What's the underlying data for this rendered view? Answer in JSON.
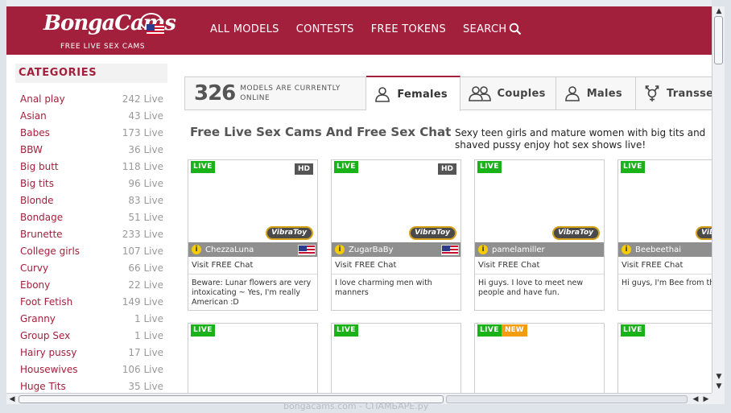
{
  "header": {
    "logo_text": "BongaCams",
    "tagline": "FREE LIVE SEX CAMS",
    "nav": [
      "ALL MODELS",
      "CONTESTS",
      "FREE TOKENS",
      "SEARCH"
    ]
  },
  "sidebar": {
    "title": "CATEGORIES",
    "categories": [
      {
        "name": "Anal play",
        "count": "242 Live"
      },
      {
        "name": "Asian",
        "count": "43 Live"
      },
      {
        "name": "Babes",
        "count": "173 Live"
      },
      {
        "name": "BBW",
        "count": "36 Live"
      },
      {
        "name": "Big butt",
        "count": "118 Live"
      },
      {
        "name": "Big tits",
        "count": "96 Live"
      },
      {
        "name": "Blonde",
        "count": "83 Live"
      },
      {
        "name": "Bondage",
        "count": "51 Live"
      },
      {
        "name": "Brunette",
        "count": "233 Live"
      },
      {
        "name": "College girls",
        "count": "107 Live"
      },
      {
        "name": "Curvy",
        "count": "66 Live"
      },
      {
        "name": "Ebony",
        "count": "22 Live"
      },
      {
        "name": "Foot Fetish",
        "count": "149 Live"
      },
      {
        "name": "Granny",
        "count": "1 Live"
      },
      {
        "name": "Group Sex",
        "count": "1 Live"
      },
      {
        "name": "Hairy pussy",
        "count": "17 Live"
      },
      {
        "name": "Housewives",
        "count": "106 Live"
      },
      {
        "name": "Huge Tits",
        "count": "35 Live"
      }
    ]
  },
  "online": {
    "count": "326",
    "text": "MODELS ARE CURRENTLY ONLINE"
  },
  "tabs": [
    {
      "label": "Females",
      "icon": "female-icon",
      "active": true
    },
    {
      "label": "Couples",
      "icon": "couple-icon",
      "active": false
    },
    {
      "label": "Males",
      "icon": "male-icon",
      "active": false
    },
    {
      "label": "Transsexual",
      "icon": "transgender-icon",
      "active": false
    }
  ],
  "main": {
    "title": "Free Live Sex Cams And Free Sex Chat",
    "subtitle": "Sexy teen girls and mature women with big tits and shaved pussy enjoy hot sex shows live!"
  },
  "badges": {
    "live": "LIVE",
    "new": "NEW",
    "hd": "HD",
    "vibratoy": "VibraToy",
    "info": "i"
  },
  "models": [
    {
      "name": "ChezzaLuna",
      "visit": "Visit FREE Chat",
      "description": "Beware: Lunar flowers are very intoxicating ~ Yes, I'm really American :D",
      "hd": true,
      "vibratoy": true,
      "flag": "us",
      "new": false
    },
    {
      "name": "ZugarBaBy",
      "visit": "Visit FREE Chat",
      "description": "I love charming men with manners",
      "hd": true,
      "vibratoy": true,
      "flag": "us",
      "new": false
    },
    {
      "name": "pamelamiller",
      "visit": "Visit FREE Chat",
      "description": "Hi guys. I love to meet new people and have fun.",
      "hd": false,
      "vibratoy": true,
      "flag": "",
      "new": false
    },
    {
      "name": "Beebeethai",
      "visit": "Visit FREE Chat",
      "description": "Hi guys, I'm Bee from thailand",
      "hd": false,
      "vibratoy": true,
      "flag": "",
      "new": false
    }
  ],
  "models_row2": [
    {
      "new": false
    },
    {
      "new": false
    },
    {
      "new": true
    },
    {
      "new": false
    }
  ],
  "statusbar": {
    "text": "bongacams.com - СПАМБАРЕ.ру"
  },
  "colors": {
    "brand": "#a3203c",
    "live": "#19b219",
    "new": "#f39c12",
    "vibratoy_border": "#d4a017"
  }
}
